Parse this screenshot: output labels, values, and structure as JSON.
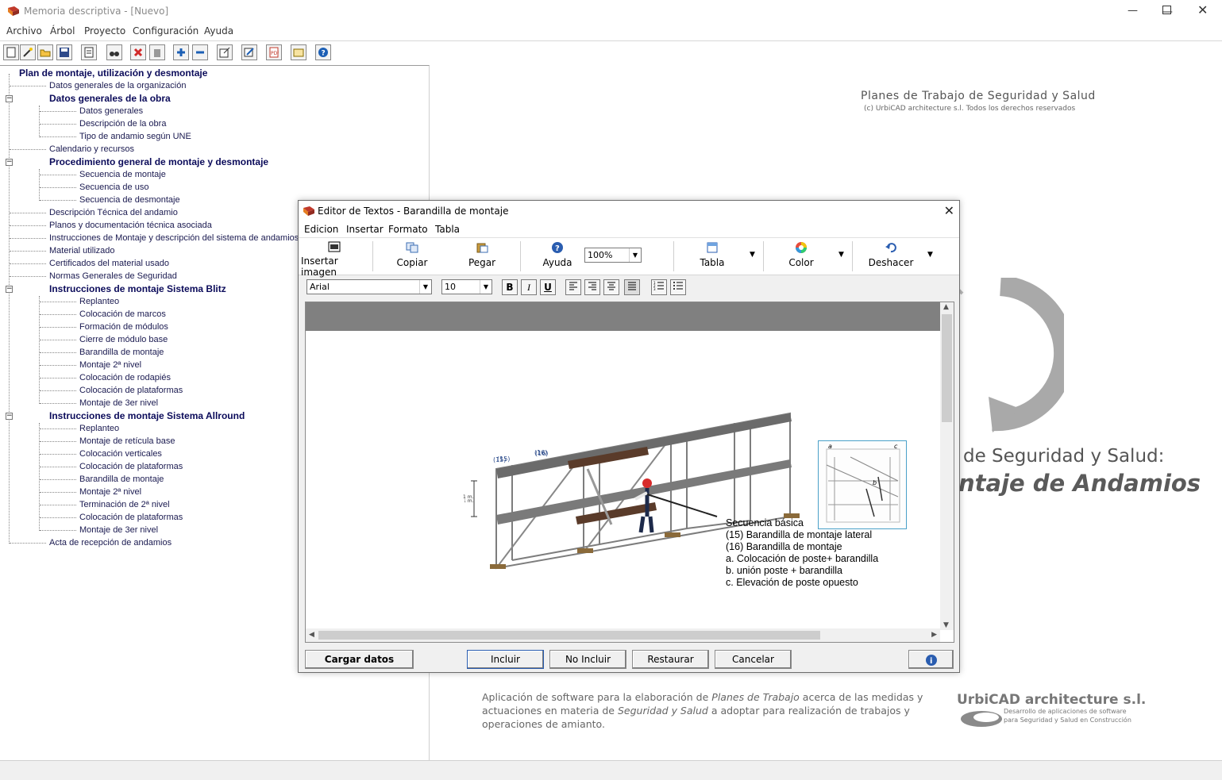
{
  "window": {
    "title": "Memoria descriptiva - [Nuevo]"
  },
  "menu": [
    "Archivo",
    "Árbol",
    "Proyecto",
    "Configuración",
    "Ayuda"
  ],
  "toolbar_icons": [
    "new-file-icon",
    "wand-icon",
    "open-folder-icon",
    "save-icon",
    "preview-icon",
    "binoculars-icon",
    "delete-icon",
    "trash-icon",
    "add-icon",
    "remove-icon",
    "export-icon",
    "edit-icon",
    "pdf-icon",
    "certificate-icon",
    "help-icon"
  ],
  "tree": {
    "root": "Plan de montaje, utilización y desmontaje",
    "items": [
      "Datos generales de la organización",
      "Datos generales de la obra",
      "Datos generales",
      "Descripción de la obra",
      "Tipo de andamio según UNE",
      "Calendario y recursos",
      "Procedimiento general de montaje y desmontaje",
      "Secuencia de montaje",
      "Secuencia de uso",
      "Secuencia de desmontaje",
      "Descripción Técnica del andamio",
      "Planos y documentación técnica asociada",
      "Instrucciones de Montaje y descripción del sistema de andamios",
      "Material utilizado",
      "Certificados del material usado",
      "Normas Generales de Seguridad",
      "Instrucciones de montaje Sistema Blitz",
      "Replanteo",
      "Colocación de marcos",
      "Formación de módulos",
      "Cierre de módulo base",
      "Barandilla de montaje",
      "Montaje 2ª nivel",
      "Colocación de rodapiés",
      "Colocación de plataformas",
      "Montaje de 3er nivel",
      "Instrucciones de montaje Sistema Allround",
      "Replanteo",
      "Montaje de retícula base",
      "Colocación verticales",
      "Colocación de plataformas",
      "Barandilla de montaje",
      "Montaje 2ª nivel",
      "Terminación de 2ª nivel",
      "Colocación de plataformas",
      "Montaje de 3er nivel",
      "Acta de recepción de andamios"
    ]
  },
  "branding": {
    "title": "Planes de Trabajo de Seguridad y Salud",
    "copyright": "(c) UrbiCAD architecture s.l.    Todos los derechos reservados",
    "big_line1": "de Seguridad y Salud:",
    "big_line2": "ntaje de Andamios",
    "footer_desc_1": "Aplicación de software para la elaboración de ",
    "footer_desc_em1": "Planes de Trabajo",
    "footer_desc_2": " acerca de las medidas y actuaciones en materia de ",
    "footer_desc_em2": "Seguridad y Salud",
    "footer_desc_3": " a adoptar para realización de trabajos y operaciones de amianto.",
    "company": "UrbiCAD architecture s.l.",
    "company_sub1": "Desarrollo de aplicaciones de software",
    "company_sub2": "para Seguridad y Salud en Construcción"
  },
  "dialog": {
    "title": "Editor de Textos - Barandilla de montaje",
    "menu": [
      "Edicion",
      "Insertar",
      "Formato",
      "Tabla"
    ],
    "ribbon": {
      "insert_image": "Insertar imagen",
      "copy": "Copiar",
      "paste": "Pegar",
      "help": "Ayuda",
      "zoom": "100%",
      "table": "Tabla",
      "color": "Color",
      "undo": "Deshacer"
    },
    "format": {
      "font": "Arial",
      "size": "10",
      "bold": "B",
      "italic": "I",
      "underline": "U"
    },
    "content": {
      "labels": {
        "l15": "(15)",
        "l16": "(16)",
        "height": "1 m."
      },
      "caption": [
        "Secuencia básica",
        "(15) Barandilla de montaje lateral",
        "(16) Barandilla de montaje",
        "a. Colocación de poste+ barandilla",
        "b. unión poste + barandilla",
        "c. Elevación de poste opuesto"
      ],
      "inset_labels": {
        "a": "a",
        "b": "b",
        "c": "c"
      }
    },
    "buttons": {
      "load": "Cargar datos",
      "include": "Incluir",
      "exclude": "No Incluir",
      "restore": "Restaurar",
      "cancel": "Cancelar"
    }
  }
}
